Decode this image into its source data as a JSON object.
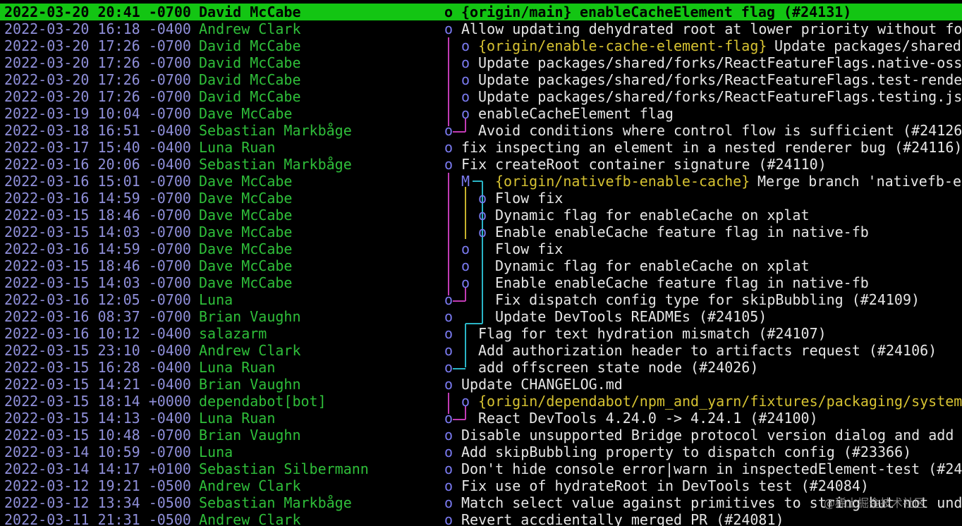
{
  "colors": {
    "date": "#8f8fd9",
    "author": "#2fbf3a",
    "node": "#7a7af0",
    "refs": "#d6c232",
    "message": "#e6e6e6",
    "selected_bg": "#13c513",
    "graph_magenta": "#c13bb4",
    "graph_yellow": "#c7b22c",
    "graph_cyan": "#2ab5c6"
  },
  "commits": [
    {
      "date": "2022-03-20 20:41 -0700",
      "author": "David McCabe",
      "node": "o",
      "refs": "{origin/main}",
      "msg": "enableCacheElement flag (#24131)",
      "col": 0,
      "selected": true
    },
    {
      "date": "2022-03-20 16:18 -0400",
      "author": "Andrew Clark",
      "node": "o",
      "refs": "",
      "msg": "Allow updating dehydrated root at lower priority without fo",
      "col": 0
    },
    {
      "date": "2022-03-20 17:26 -0700",
      "author": "David McCabe",
      "node": "o",
      "refs": "{origin/enable-cache-element-flag}",
      "msg": "Update packages/shared/",
      "col": 1
    },
    {
      "date": "2022-03-20 17:26 -0700",
      "author": "David McCabe",
      "node": "o",
      "refs": "",
      "msg": "Update packages/shared/forks/ReactFeatureFlags.native-oss",
      "col": 1
    },
    {
      "date": "2022-03-20 17:26 -0700",
      "author": "David McCabe",
      "node": "o",
      "refs": "",
      "msg": "Update packages/shared/forks/ReactFeatureFlags.test-rende",
      "col": 1
    },
    {
      "date": "2022-03-20 17:26 -0700",
      "author": "David McCabe",
      "node": "o",
      "refs": "",
      "msg": "Update packages/shared/forks/ReactFeatureFlags.testing.js",
      "col": 1
    },
    {
      "date": "2022-03-19 10:04 -0700",
      "author": "Dave McCabe",
      "node": "o",
      "refs": "",
      "msg": "enableCacheElement flag",
      "col": 1
    },
    {
      "date": "2022-03-18 16:51 -0400",
      "author": "Sebastian Markbåge",
      "node": "o",
      "refs": "",
      "msg": "Avoid conditions where control flow is sufficient (#24126",
      "col": 0,
      "msgcol": 1
    },
    {
      "date": "2022-03-17 15:40 -0400",
      "author": "Luna Ruan",
      "node": "o",
      "refs": "",
      "msg": "fix inspecting an element in a nested renderer bug (#24116)",
      "col": 0
    },
    {
      "date": "2022-03-16 20:06 -0400",
      "author": "Sebastian Markbåge",
      "node": "o",
      "refs": "",
      "msg": "Fix createRoot container signature (#24110)",
      "col": 0
    },
    {
      "date": "2022-03-16 15:01 -0700",
      "author": "Dave McCabe",
      "node": "M",
      "refs": "{origin/nativefb-enable-cache}",
      "msg": "Merge branch 'nativefb-e",
      "col": 1,
      "msgcol": 2
    },
    {
      "date": "2022-03-16 14:59 -0700",
      "author": "Dave McCabe",
      "node": "o",
      "refs": "",
      "msg": "Flow fix",
      "col": 2
    },
    {
      "date": "2022-03-15 18:46 -0700",
      "author": "Dave McCabe",
      "node": "o",
      "refs": "",
      "msg": "Dynamic flag for enableCache on xplat",
      "col": 2
    },
    {
      "date": "2022-03-15 14:03 -0700",
      "author": "Dave McCabe",
      "node": "o",
      "refs": "",
      "msg": "Enable enableCache feature flag in native-fb",
      "col": 2
    },
    {
      "date": "2022-03-16 14:59 -0700",
      "author": "Dave McCabe",
      "node": "o",
      "refs": "",
      "msg": "Flow fix",
      "col": 1,
      "msgcol": 2
    },
    {
      "date": "2022-03-15 18:46 -0700",
      "author": "Dave McCabe",
      "node": "o",
      "refs": "",
      "msg": "Dynamic flag for enableCache on xplat",
      "col": 1,
      "msgcol": 2
    },
    {
      "date": "2022-03-15 14:03 -0700",
      "author": "Dave McCabe",
      "node": "o",
      "refs": "",
      "msg": "Enable enableCache feature flag in native-fb",
      "col": 1,
      "msgcol": 2
    },
    {
      "date": "2022-03-16 12:05 -0700",
      "author": "Luna",
      "node": "o",
      "refs": "",
      "msg": "Fix dispatch config type for skipBubbling (#24109)",
      "col": 0,
      "msgcol": 2
    },
    {
      "date": "2022-03-16 08:37 -0700",
      "author": "Brian Vaughn",
      "node": "o",
      "refs": "",
      "msg": "Update DevTools READMEs (#24105)",
      "col": 0,
      "msgcol": 2
    },
    {
      "date": "2022-03-16 10:12 -0400",
      "author": "salazarm",
      "node": "o",
      "refs": "",
      "msg": "Flag for text hydration mismatch (#24107)",
      "col": 0,
      "msgcol": 1
    },
    {
      "date": "2022-03-15 23:10 -0400",
      "author": "Andrew Clark",
      "node": "o",
      "refs": "",
      "msg": "Add authorization header to artifacts request (#24106)",
      "col": 0,
      "msgcol": 1
    },
    {
      "date": "2022-03-15 16:28 -0400",
      "author": "Luna Ruan",
      "node": "o",
      "refs": "",
      "msg": "add offscreen state node (#24026)",
      "col": 0,
      "msgcol": 1
    },
    {
      "date": "2022-03-15 14:21 -0400",
      "author": "Brian Vaughn",
      "node": "o",
      "refs": "",
      "msg": "Update CHANGELOG.md",
      "col": 0
    },
    {
      "date": "2022-03-15 18:14 +0000",
      "author": "dependabot[bot]",
      "node": "o",
      "refs": "{origin/dependabot/npm_and_yarn/fixtures/packaging/system",
      "msg": "",
      "col": 1
    },
    {
      "date": "2022-03-15 14:13 -0400",
      "author": "Luna Ruan",
      "node": "o",
      "refs": "",
      "msg": "React DevTools 4.24.0 -> 4.24.1 (#24100)",
      "col": 0,
      "msgcol": 1
    },
    {
      "date": "2022-03-15 10:48 -0700",
      "author": "Brian Vaughn",
      "node": "o",
      "refs": "",
      "msg": "Disable unsupported Bridge protocol version dialog and add w",
      "col": 0
    },
    {
      "date": "2022-03-14 10:59 -0700",
      "author": "Luna",
      "node": "o",
      "refs": "",
      "msg": "Add skipBubbling property to dispatch config (#23366)",
      "col": 0
    },
    {
      "date": "2022-03-14 14:17 +0100",
      "author": "Sebastian Silbermann",
      "node": "o",
      "refs": "",
      "msg": "Don't hide console error|warn in inspectedElement-test (#24",
      "col": 0
    },
    {
      "date": "2022-03-12 19:21 -0500",
      "author": "Andrew Clark",
      "node": "o",
      "refs": "",
      "msg": "Fix use of hydrateRoot in DevTools test (#24084)",
      "col": 0
    },
    {
      "date": "2022-03-12 13:34 -0500",
      "author": "Sebastian Markbåge",
      "node": "o",
      "refs": "",
      "msg": "Match select value against primitives to string but not unde",
      "col": 0
    },
    {
      "date": "2022-03-11 21:31 -0500",
      "author": "Andrew Clark",
      "node": "o",
      "refs": "",
      "msg": "Revert accdientally merged PR (#24081)",
      "col": 0
    }
  ],
  "watermark": "@稀土掘金技术社区"
}
